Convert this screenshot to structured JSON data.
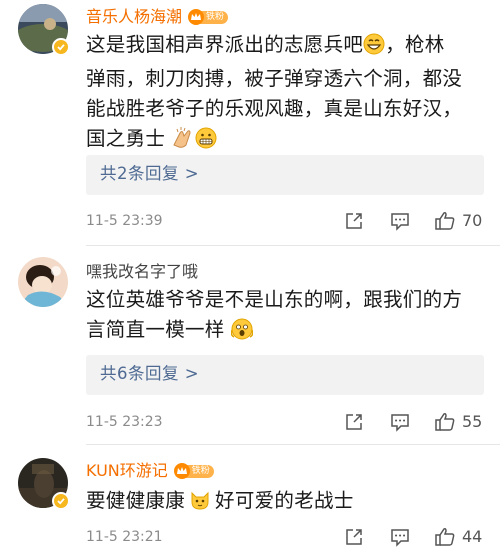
{
  "comments": [
    {
      "username": "音乐人杨海潮",
      "badge_label": "铁粉",
      "text_lines": [
        "这是我国相声界派出的志愿兵吧",
        "，枪林",
        "弹雨，刺刀肉搏，被子弹穿透六个洞，都没",
        "能战胜老爷子的乐观风趣，真是山东好汉，",
        "国之勇士"
      ],
      "replies_label": "共2条回复 >",
      "time": "11-5 23:39",
      "likes": "70"
    },
    {
      "username": "嘿我改名字了哦",
      "text_lines": [
        "这位英雄爷爷是不是山东的啊，跟我们的方",
        "言简直一模一样"
      ],
      "replies_label": "共6条回复 >",
      "time": "11-5 23:23",
      "likes": "55"
    },
    {
      "username": "KUN环游记",
      "badge_label": "铁粉",
      "text_lines": [
        "要健健康康",
        "好可爱的老战士"
      ],
      "time": "11-5 23:21",
      "likes": "44"
    }
  ],
  "colors": {
    "username_vip": "#f46f00",
    "reply_link": "#4e6a93",
    "meta_gray": "#8b8b8b"
  },
  "icons": [
    "forward-icon",
    "comment-icon",
    "like-icon",
    "verified-icon",
    "crown-icon",
    "grin-emoji",
    "clap-emoji",
    "grimace-emoji",
    "scared-emoji",
    "cat-emoji"
  ]
}
